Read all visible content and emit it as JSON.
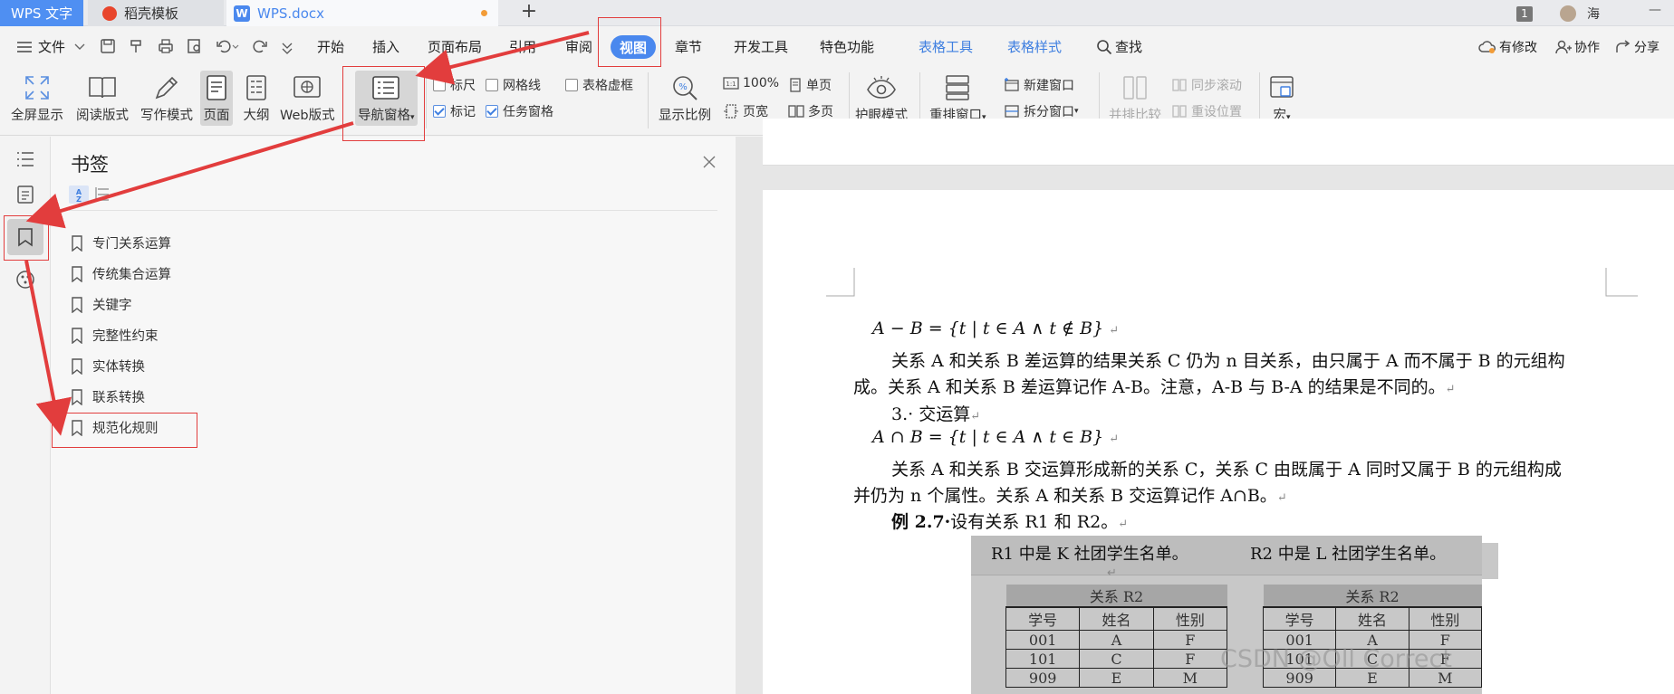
{
  "titlebar": {
    "tabs": [
      "WPS 文字",
      "稻壳模板",
      "WPS.docx"
    ],
    "new_tab": "+",
    "badge": "1",
    "user": "海",
    "minimize": "—"
  },
  "menubar": {
    "file": "文件",
    "items": [
      "开始",
      "插入",
      "页面布局",
      "引用",
      "审阅",
      "视图",
      "章节",
      "开发工具",
      "特色功能"
    ],
    "context_items": [
      "表格工具",
      "表格样式"
    ],
    "search": "查找",
    "right": [
      "有修改",
      "协作",
      "分享"
    ]
  },
  "ribbon": {
    "big_buttons": [
      "全屏显示",
      "阅读版式",
      "写作模式",
      "页面",
      "大纲",
      "Web版式"
    ],
    "nav_pane": "导航窗格",
    "checkboxes": [
      {
        "label": "标尺",
        "checked": false
      },
      {
        "label": "网格线",
        "checked": false
      },
      {
        "label": "表格虚框",
        "checked": false
      },
      {
        "label": "标记",
        "checked": true
      },
      {
        "label": "任务窗格",
        "checked": true
      }
    ],
    "zoom_big": "显示比例",
    "zoom_small": [
      "100%",
      "单页",
      "页宽",
      "多页"
    ],
    "eye_mode": "护眼模式",
    "rearrange": "重排窗口",
    "new_window": "新建窗口",
    "split_window": "拆分窗口",
    "compare": "并排比较",
    "sync_scroll": "同步滚动",
    "reset_pos": "重设位置",
    "macro": "宏"
  },
  "panel": {
    "title": "书签",
    "bookmarks": [
      "专门关系运算",
      "传统集合运算",
      "关键字",
      "完整性约束",
      "实体转换",
      "联系转换",
      "规范化规则"
    ]
  },
  "document": {
    "formula1": "A − B = {t | t ∈ A ∧ t ∉ B}",
    "p1_line1": "关系 A 和关系 B 差运算的结果关系 C 仍为 n 目关系，由只属于 A 而不属于 B 的元组构",
    "p1_line2": "成。关系 A 和关系 B 差运算记作 A-B。注意，A-B 与 B-A 的结果是不同的。",
    "heading3": "3.· 交运算",
    "formula2": "A ∩ B = {t | t ∈ A ∧ t ∈ B}",
    "p2_line1": "关系 A 和关系 B 交运算形成新的关系 C，关系 C 由既属于 A 同时又属于 B 的元组构成",
    "p2_line2": "并仍为 n 个属性。关系 A 和关系 B 交运算记作 A∩B。",
    "example_label": "例 2.7·",
    "example_text": "设有关系 R1 和 R2。",
    "caption_left": "R1 中是 K 社团学生名单。",
    "caption_right": "R2 中是 L 社团学生名单。",
    "table_left": {
      "title": "关系 R2",
      "headers": [
        "学号",
        "姓名",
        "性别"
      ],
      "rows": [
        [
          "001",
          "A",
          "F"
        ],
        [
          "101",
          "C",
          "F"
        ],
        [
          "909",
          "E",
          "M"
        ]
      ]
    },
    "table_right": {
      "title": "关系 R2",
      "headers": [
        "学号",
        "姓名",
        "性别"
      ],
      "rows": [
        [
          "001",
          "A",
          "F"
        ],
        [
          "101",
          "C",
          "F"
        ],
        [
          "909",
          "E",
          "M"
        ]
      ]
    }
  },
  "watermark": "CSDN @Oll Correct"
}
